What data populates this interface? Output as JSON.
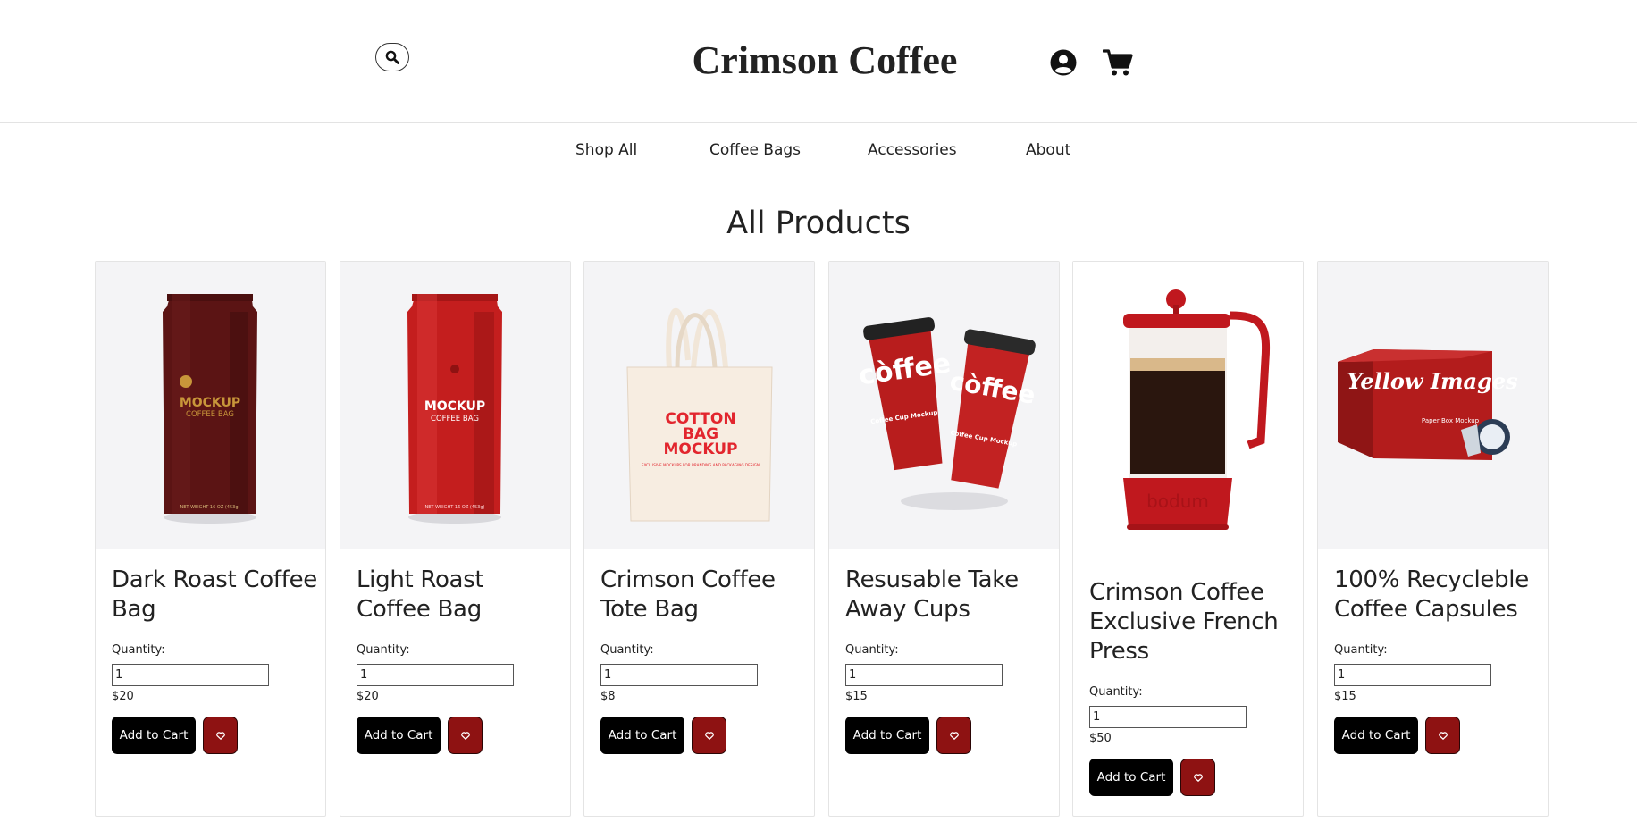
{
  "header": {
    "brand": "Crimson Coffee",
    "search_icon": "search-icon",
    "account_icon": "account-circle-icon",
    "cart_icon": "shopping-cart-icon"
  },
  "nav": {
    "items": [
      "Shop All",
      "Coffee Bags",
      "Accessories",
      "About"
    ]
  },
  "page_title": "All Products",
  "colors": {
    "accent_red": "#8e1212",
    "button_black": "#000000",
    "image_background": "#f4f4f6"
  },
  "products": [
    {
      "name": "Dark Roast Coffee Bag",
      "quantity_label": "Quantity:",
      "quantity": "1",
      "price": "$20",
      "add_label": "Add to Cart",
      "favorite_icon": "heart-icon",
      "image": {
        "kind": "coffee-bag",
        "color": "#5b1414",
        "text1": "MOCKUP",
        "text2": "COFFEE BAG",
        "text3": "NET WEIGHT 16 OZ (453g)"
      }
    },
    {
      "name": "Light Roast Coffee Bag",
      "quantity_label": "Quantity:",
      "quantity": "1",
      "price": "$20",
      "add_label": "Add to Cart",
      "favorite_icon": "heart-icon",
      "image": {
        "kind": "coffee-bag",
        "color": "#c41e1e",
        "text1": "MOCKUP",
        "text2": "COFFEE BAG",
        "text3": "NET WEIGHT 16 OZ (453g)"
      }
    },
    {
      "name": "Crimson Coffee Tote Bag",
      "quantity_label": "Quantity:",
      "quantity": "1",
      "price": "$8",
      "add_label": "Add to Cart",
      "favorite_icon": "heart-icon",
      "image": {
        "kind": "tote-bag",
        "text1": "COTTON",
        "text2": "BAG",
        "text3": "MOCKUP",
        "text4": "EXCLUSIVE MOCKUPS FOR BRANDING AND PACKAGING DESIGN"
      }
    },
    {
      "name": "Resusable Take Away Cups",
      "quantity_label": "Quantity:",
      "quantity": "1",
      "price": "$15",
      "add_label": "Add to Cart",
      "favorite_icon": "heart-icon",
      "image": {
        "kind": "cups",
        "text1": "còffee",
        "text2": "Coffee Cup Mockup"
      }
    },
    {
      "name": "Crimson Coffee Exclusive French Press",
      "quantity_label": "Quantity:",
      "quantity": "1",
      "price": "$50",
      "add_label": "Add to Cart",
      "favorite_icon": "heart-icon",
      "image": {
        "kind": "french-press",
        "text1": "bodum"
      }
    },
    {
      "name": "100% Recycleble Coffee Capsules",
      "quantity_label": "Quantity:",
      "quantity": "1",
      "price": "$15",
      "add_label": "Add to Cart",
      "favorite_icon": "heart-icon",
      "image": {
        "kind": "capsule-box",
        "text1": "Yellow Images",
        "text2": "Paper Box Mockup"
      }
    }
  ]
}
